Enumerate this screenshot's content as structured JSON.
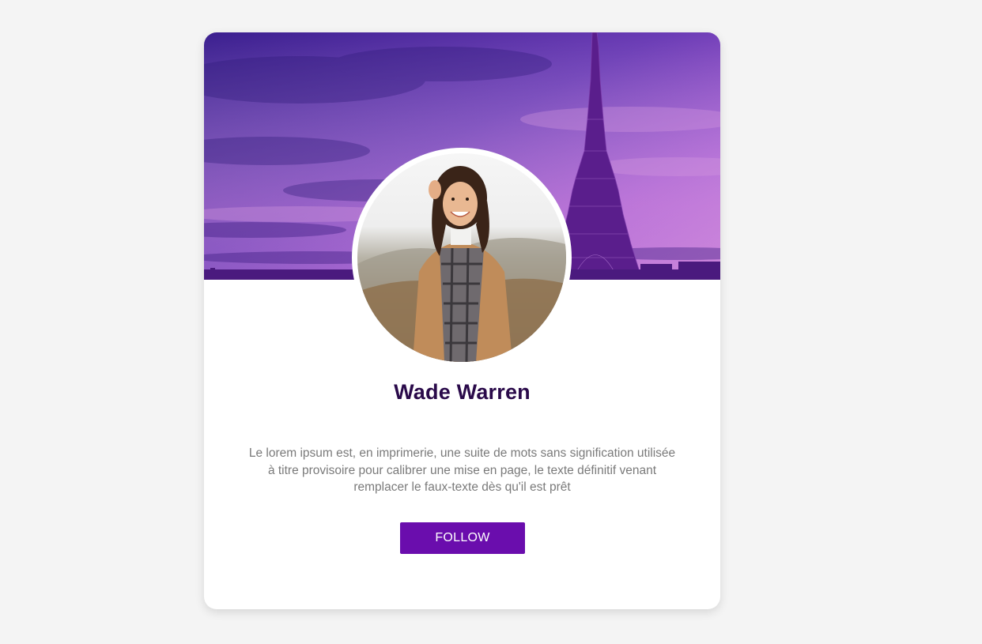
{
  "profile": {
    "name": "Wade Warren",
    "bio": "Le lorem ipsum est, en imprimerie, une suite de mots sans signification utilisée à titre provisoire pour calibrer une mise en page, le texte définitif venant remplacer le faux-texte dès qu'il est prêt",
    "follow_label": "FOLLOW"
  },
  "colors": {
    "page_background": "#f4f4f4",
    "card_background": "#ffffff",
    "name_text": "#2a0a4a",
    "bio_text": "#7a7a7a",
    "button_background": "#6a0dad",
    "button_text": "#ffffff",
    "cover_gradient": [
      "#4a1f9e",
      "#9a4fd0",
      "#c77ad8"
    ]
  },
  "images": {
    "cover": "eiffel-tower-purple-sky",
    "avatar": "woman-in-camel-coat-and-plaid-scarf"
  }
}
